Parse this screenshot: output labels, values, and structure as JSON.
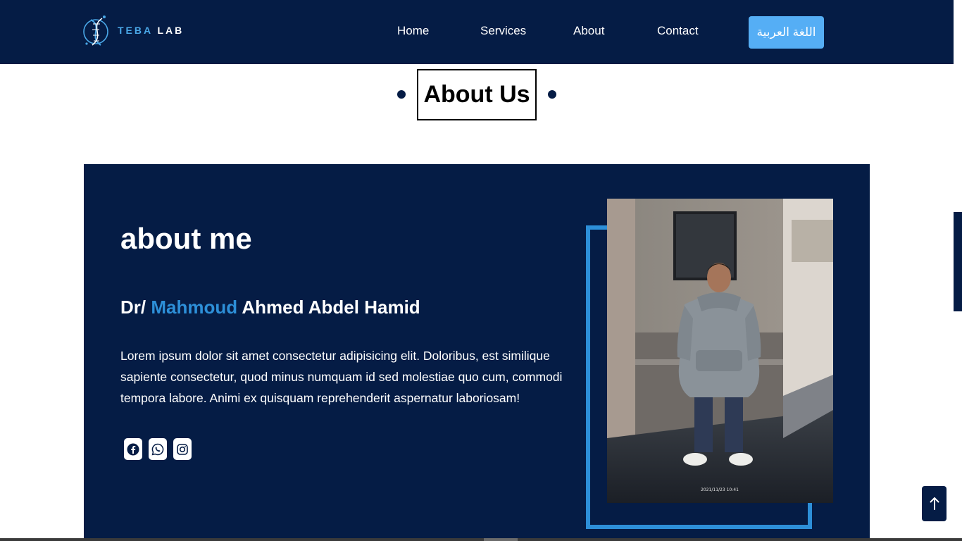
{
  "brand": {
    "word1": "TEBA",
    "word2": "LAB",
    "logo_icon": "dna-helix-icon"
  },
  "nav": {
    "items": [
      {
        "label": "Home"
      },
      {
        "label": "Services"
      },
      {
        "label": "About"
      },
      {
        "label": "Contact"
      }
    ],
    "language_button": "اللغة العربية"
  },
  "section": {
    "title": "About Us"
  },
  "about": {
    "heading": "about me",
    "name_prefix": "Dr/",
    "name_highlight": "Mahmoud",
    "name_rest": "Ahmed Abdel Hamid",
    "bio": "Lorem ipsum dolor sit amet consectetur adipisicing elit. Doloribus, est similique sapiente consectetur, quod minus numquam id sed molestiae quo cum, commodi tempora labore. Animi ex quisquam reprehenderit aspernatur laboriosam!",
    "socials": [
      {
        "icon": "facebook-icon"
      },
      {
        "icon": "whatsapp-icon"
      },
      {
        "icon": "instagram-icon"
      }
    ],
    "photo_timestamp": "2021/11/23 10:41"
  },
  "colors": {
    "navy": "#051c45",
    "accent_blue": "#2d8fd8",
    "button_blue": "#55aef5"
  },
  "back_to_top_icon": "arrow-up-icon"
}
